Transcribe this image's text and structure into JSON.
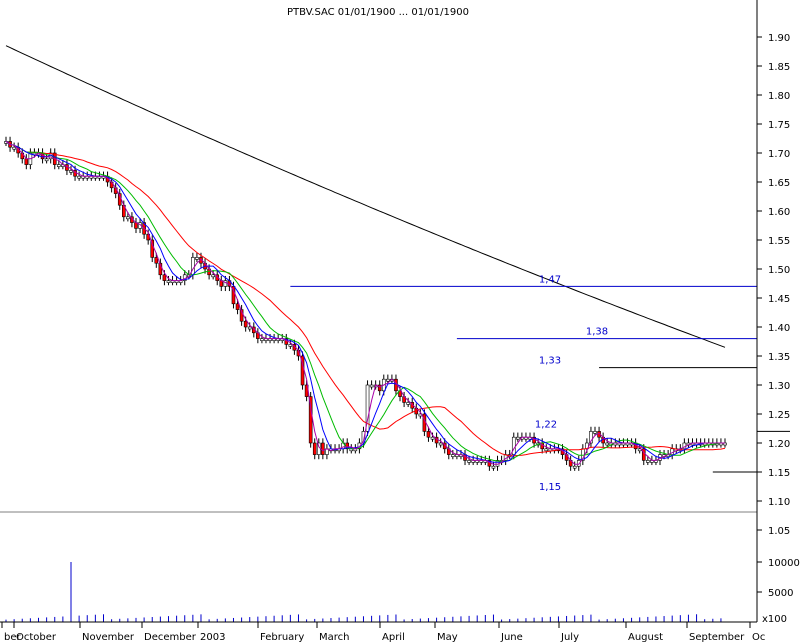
{
  "chart_data": {
    "type": "candlestick",
    "title": "PTBV.SAC  01/01/1900 ... 01/01/1900",
    "grid": false,
    "price_axis": {
      "ylim": [
        1.05,
        1.95
      ],
      "ticks": [
        "1.90",
        "1.85",
        "1.80",
        "1.75",
        "1.70",
        "1.65",
        "1.60",
        "1.55",
        "1.50",
        "1.45",
        "1.40",
        "1.35",
        "1.30",
        "1.25",
        "1.20",
        "1.15",
        "1.10",
        "1.05"
      ]
    },
    "volume_axis": {
      "ylim": [
        0,
        14000
      ],
      "ticks": [
        "10000",
        "5000"
      ],
      "unit_label": "x100"
    },
    "x_axis": {
      "month_labels": [
        "ber",
        "October",
        "November",
        "December",
        "2003",
        "February",
        "March",
        "April",
        "May",
        "June",
        "July",
        "August",
        "September",
        "Oc"
      ]
    },
    "levels": [
      {
        "label": "1,47",
        "value": 1.47,
        "x_start": 70
      },
      {
        "label": "1,38",
        "value": 1.38,
        "x_start": 111
      },
      {
        "label": "1,33",
        "value": 1.33,
        "x_start": 146
      },
      {
        "label": "1,22",
        "value": 1.22,
        "x_start": 193
      },
      {
        "label": "1,15",
        "value": 1.15,
        "x_start": 174
      }
    ],
    "price_series": [
      1.72,
      1.71,
      1.71,
      1.7,
      1.69,
      1.68,
      1.7,
      1.7,
      1.7,
      1.69,
      1.69,
      1.7,
      1.68,
      1.68,
      1.68,
      1.67,
      1.67,
      1.66,
      1.66,
      1.66,
      1.66,
      1.66,
      1.66,
      1.66,
      1.66,
      1.65,
      1.64,
      1.63,
      1.61,
      1.59,
      1.59,
      1.58,
      1.57,
      1.58,
      1.56,
      1.55,
      1.52,
      1.51,
      1.49,
      1.48,
      1.48,
      1.48,
      1.48,
      1.48,
      1.49,
      1.49,
      1.52,
      1.52,
      1.51,
      1.5,
      1.49,
      1.49,
      1.48,
      1.47,
      1.48,
      1.47,
      1.44,
      1.43,
      1.41,
      1.4,
      1.4,
      1.39,
      1.38,
      1.38,
      1.38,
      1.38,
      1.38,
      1.38,
      1.38,
      1.37,
      1.37,
      1.36,
      1.35,
      1.3,
      1.28,
      1.2,
      1.18,
      1.2,
      1.18,
      1.19,
      1.19,
      1.19,
      1.19,
      1.2,
      1.19,
      1.19,
      1.19,
      1.2,
      1.22,
      1.3,
      1.3,
      1.3,
      1.29,
      1.31,
      1.31,
      1.31,
      1.29,
      1.28,
      1.27,
      1.27,
      1.26,
      1.25,
      1.25,
      1.22,
      1.21,
      1.21,
      1.2,
      1.2,
      1.19,
      1.18,
      1.18,
      1.18,
      1.18,
      1.17,
      1.17,
      1.17,
      1.17,
      1.17,
      1.17,
      1.16,
      1.16,
      1.17,
      1.17,
      1.18,
      1.18,
      1.21,
      1.21,
      1.21,
      1.21,
      1.21,
      1.2,
      1.2,
      1.19,
      1.19,
      1.19,
      1.19,
      1.19,
      1.18,
      1.17,
      1.16,
      1.16,
      1.17,
      1.19,
      1.2,
      1.22,
      1.22,
      1.21,
      1.2,
      1.2,
      1.2,
      1.2,
      1.2,
      1.2,
      1.2,
      1.2,
      1.19,
      1.19,
      1.17,
      1.17,
      1.17,
      1.17,
      1.18,
      1.18,
      1.18,
      1.19,
      1.19,
      1.19,
      1.2,
      1.2,
      1.2,
      1.2,
      1.2,
      1.2,
      1.2,
      1.2,
      1.2,
      1.2,
      1.2
    ],
    "volume_spikes": [
      {
        "index": 16,
        "value": 10000
      },
      {
        "index": 184,
        "value": 4500
      },
      {
        "index": 189,
        "value": 2000
      }
    ],
    "moving_average_colors": [
      "#000000",
      "#ff0000",
      "#00bb00",
      "#0000ff",
      "#aa00aa"
    ]
  }
}
